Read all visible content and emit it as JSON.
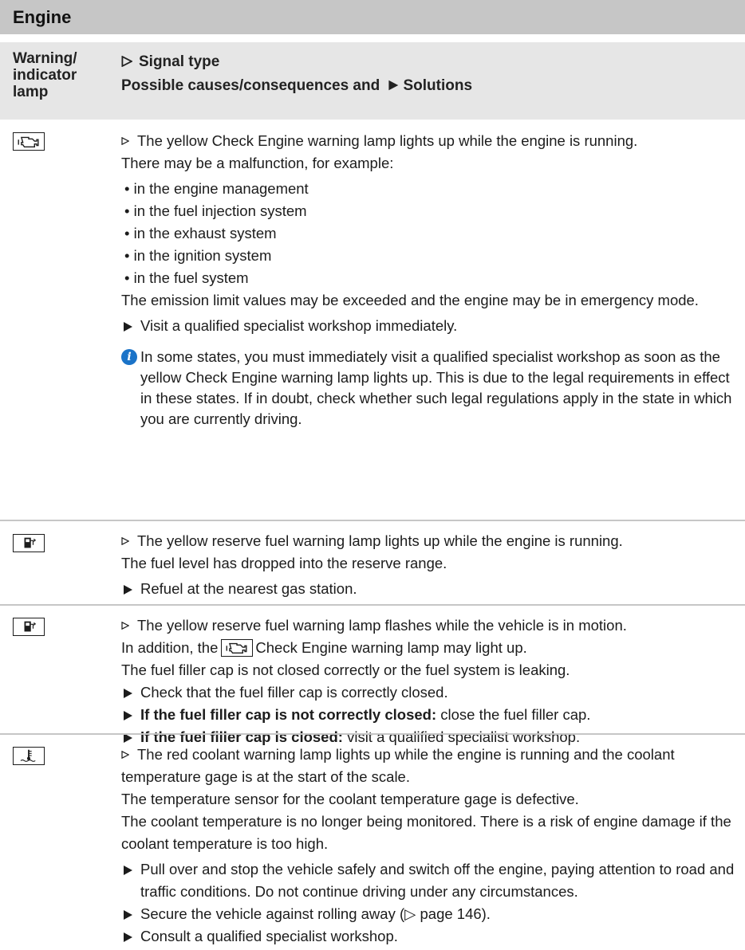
{
  "section_title": "Engine",
  "header": {
    "col1": "Warning/\nindicator\nlamp",
    "col2_line1": "Signal type",
    "col2_line2_pre": "Possible causes/consequences and",
    "col2_line2_post": "Solutions"
  },
  "rows": [
    {
      "icon": "check-engine-icon",
      "signal": "The yellow Check Engine warning lamp lights up while the engine is running.",
      "cause_intro": "There may be a malfunction, for example:",
      "bullets": [
        "in the engine management",
        "in the fuel injection system",
        "in the exhaust system",
        "in the ignition system",
        "in the fuel system"
      ],
      "consequence": "The emission limit values may be exceeded and the engine may be in emergency mode.",
      "action": "Visit a qualified specialist workshop immediately.",
      "note": "In some states, you must immediately visit a qualified specialist workshop as soon as the yellow Check Engine warning lamp lights up. This is due to the legal requirements in effect in these states. If in doubt, check whether such legal regulations apply in the state in which you are currently driving."
    },
    {
      "icon": "fuel-pump-icon",
      "signal": "The yellow reserve fuel warning lamp lights up while the engine is running.",
      "cause": "The fuel level has dropped into the reserve range.",
      "action": "Refuel at the nearest gas station."
    },
    {
      "icon": "fuel-pump-icon",
      "signal": "The yellow reserve fuel warning lamp flashes while the vehicle is in motion.",
      "addition_pre": "In addition, the",
      "addition_post": "Check Engine warning lamp may light up.",
      "cause": "The fuel filler cap is not closed correctly or the fuel system is leaking.",
      "action1": "Check that the fuel filler cap is correctly closed.",
      "action2_bold": "If the fuel filler cap is not correctly closed:",
      "action2_rest": "close the fuel filler cap.",
      "action3_bold": "If the fuel filler cap is closed:",
      "action3_rest": "visit a qualified specialist workshop."
    },
    {
      "icon": "coolant-temperature-icon",
      "signal": "The red coolant warning lamp lights up while the engine is running and the coolant temperature gage is at the start of the scale.",
      "cause1": "The temperature sensor for the coolant temperature gage is defective.",
      "cause2": "The coolant temperature is no longer being monitored. There is a risk of engine damage if the coolant temperature is too high.",
      "action1": "Pull over and stop the vehicle safely and switch off the engine, paying attention to road and traffic conditions. Do not continue driving under any circumstances.",
      "action2": "Secure the vehicle against rolling away (▷ page 146).",
      "action3": "Consult a qualified specialist workshop."
    }
  ]
}
